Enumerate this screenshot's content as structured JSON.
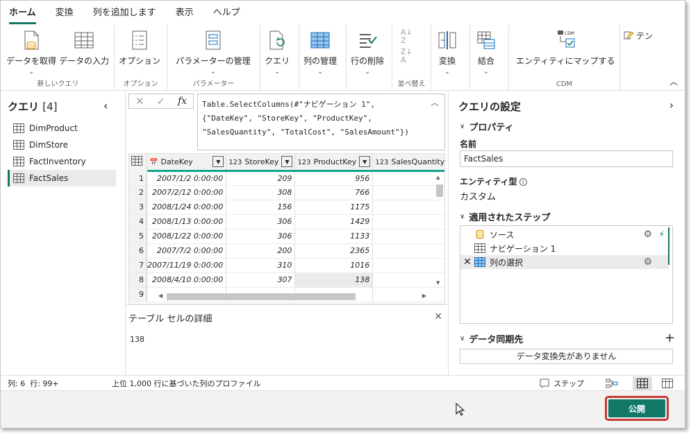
{
  "tabs": [
    "ホーム",
    "変換",
    "列を追加します",
    "表示",
    "ヘルプ"
  ],
  "ribbon": {
    "get_data": "データを取得",
    "enter_data": "データの入力",
    "group_new_query": "新しいクエリ",
    "options": "オプション",
    "group_options": "オプション",
    "manage_params": "パラメーターの管理",
    "group_params": "パラメーター",
    "query": "クエリ",
    "manage_columns": "列の管理",
    "remove_rows": "行の削除",
    "group_sort": "並べ替え",
    "transform": "変換",
    "combine": "結合",
    "map_entity": "エンティティにマップする",
    "group_cdm": "CDM",
    "template_partial": "テン",
    "cdm_badge": "CDM"
  },
  "queries": {
    "title": "クエリ",
    "count": "[4]",
    "items": [
      "DimProduct",
      "DimStore",
      "FactInventory",
      "FactSales"
    ]
  },
  "formula": {
    "fx": "fx",
    "text": "Table.SelectColumns(#\"ナビゲーション 1\",\n{\"DateKey\", \"StoreKey\", \"ProductKey\",\n\"SalesQuantity\", \"TotalCost\", \"SalesAmount\"})"
  },
  "grid": {
    "columns": [
      {
        "type": "date",
        "name": "DateKey"
      },
      {
        "type": "123",
        "name": "StoreKey"
      },
      {
        "type": "123",
        "name": "ProductKey"
      },
      {
        "type": "123",
        "name": "SalesQuantity"
      }
    ],
    "rows": [
      [
        "1",
        "2007/1/2 0:00:00",
        "209",
        "956",
        ""
      ],
      [
        "2",
        "2007/2/12 0:00:00",
        "308",
        "766",
        ""
      ],
      [
        "3",
        "2008/1/24 0:00:00",
        "156",
        "1175",
        ""
      ],
      [
        "4",
        "2008/1/13 0:00:00",
        "306",
        "1429",
        ""
      ],
      [
        "5",
        "2008/1/22 0:00:00",
        "306",
        "1133",
        ""
      ],
      [
        "6",
        "2007/7/2 0:00:00",
        "200",
        "2365",
        ""
      ],
      [
        "7",
        "2007/11/19 0:00:00",
        "310",
        "1016",
        ""
      ],
      [
        "8",
        "2008/4/10 0:00:00",
        "307",
        "138",
        ""
      ],
      [
        "9",
        "",
        "",
        "",
        ""
      ]
    ]
  },
  "detail": {
    "title": "テーブル セルの詳細",
    "value": "138"
  },
  "settings": {
    "title": "クエリの設定",
    "properties": "プロパティ",
    "name_label": "名前",
    "name_value": "FactSales",
    "entity_label": "エンティティ型",
    "entity_value": "カスタム",
    "steps_title": "適用されたステップ",
    "steps": [
      "ソース",
      "ナビゲーション 1",
      "列の選択"
    ],
    "dest_title": "データ同期先",
    "dest_value": "データ変換先がありません"
  },
  "status": {
    "columns": "列: 6",
    "rows": "行: 99+",
    "profile": "上位 1,000 行に基づいた列のプロファイル",
    "steps_btn": "ステップ"
  },
  "footer": {
    "publish": "公開"
  },
  "colors": {
    "accent": "#117865",
    "header_teal": "#10a58c",
    "highlight_border": "#c23934"
  }
}
